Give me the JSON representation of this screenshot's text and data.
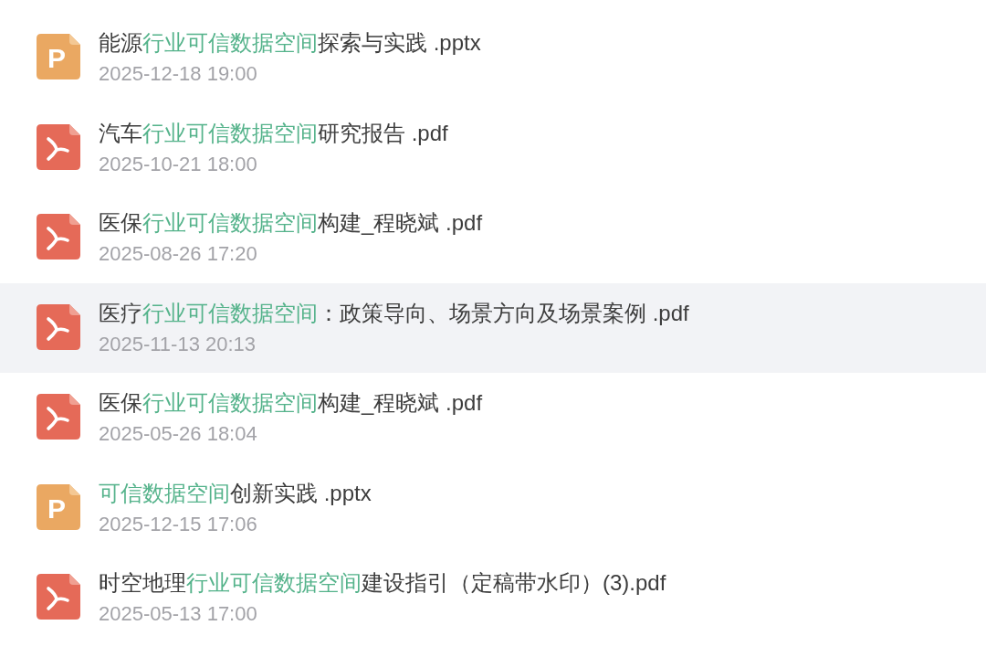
{
  "files": [
    {
      "kind": "pptx",
      "icon_label": "P",
      "selected": false,
      "name_parts": [
        {
          "text": "能源",
          "highlight": false
        },
        {
          "text": "行业可信数据空间",
          "highlight": true
        },
        {
          "text": "探索与实践 .pptx",
          "highlight": false
        }
      ],
      "date": "2025-12-18 19:00"
    },
    {
      "kind": "pdf",
      "selected": false,
      "name_parts": [
        {
          "text": "汽车",
          "highlight": false
        },
        {
          "text": "行业可信数据空间",
          "highlight": true
        },
        {
          "text": "研究报告 .pdf",
          "highlight": false
        }
      ],
      "date": "2025-10-21 18:00"
    },
    {
      "kind": "pdf",
      "selected": false,
      "name_parts": [
        {
          "text": "医保",
          "highlight": false
        },
        {
          "text": "行业可信数据空间",
          "highlight": true
        },
        {
          "text": "构建_程晓斌 .pdf",
          "highlight": false
        }
      ],
      "date": "2025-08-26 17:20"
    },
    {
      "kind": "pdf",
      "selected": true,
      "name_parts": [
        {
          "text": "医疗",
          "highlight": false
        },
        {
          "text": "行业可信数据空间",
          "highlight": true
        },
        {
          "text": "：政策导向、场景方向及场景案例 .pdf",
          "highlight": false
        }
      ],
      "date": "2025-11-13 20:13"
    },
    {
      "kind": "pdf",
      "selected": false,
      "name_parts": [
        {
          "text": "医保",
          "highlight": false
        },
        {
          "text": "行业可信数据空间",
          "highlight": true
        },
        {
          "text": "构建_程晓斌 .pdf",
          "highlight": false
        }
      ],
      "date": "2025-05-26 18:04"
    },
    {
      "kind": "pptx",
      "icon_label": "P",
      "selected": false,
      "name_parts": [
        {
          "text": "可信数据空间",
          "highlight": true
        },
        {
          "text": "创新实践 .pptx",
          "highlight": false
        }
      ],
      "date": "2025-12-15 17:06"
    },
    {
      "kind": "pdf",
      "selected": false,
      "name_parts": [
        {
          "text": "时空地理",
          "highlight": false
        },
        {
          "text": "行业可信数据空间",
          "highlight": true
        },
        {
          "text": "建设指引（定稿带水印）(3).pdf",
          "highlight": false
        }
      ],
      "date": "2025-05-13 17:00"
    }
  ]
}
